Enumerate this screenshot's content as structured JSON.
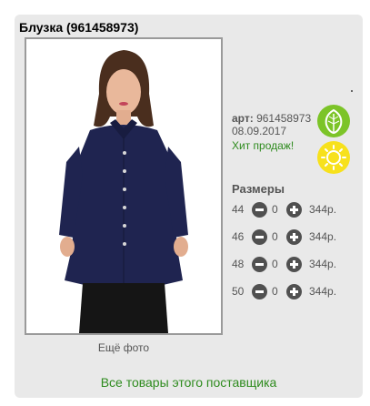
{
  "product": {
    "title": "Блузка (961458973)",
    "more_photos": "Ещё фото",
    "art_label": "арт:",
    "art_value": "961458973",
    "date": "08.09.2017",
    "hit": "Хит продаж!",
    "badges": [
      "leaf-icon",
      "sun-icon"
    ],
    "colors": {
      "accent_green": "#2e8b1e",
      "leaf_badge": "#7cc428",
      "sun_badge": "#f7e11c"
    }
  },
  "sizes": {
    "title": "Размеры",
    "rows": [
      {
        "size": "44",
        "qty": "0",
        "price": "344р."
      },
      {
        "size": "46",
        "qty": "0",
        "price": "344р."
      },
      {
        "size": "48",
        "qty": "0",
        "price": "344р."
      },
      {
        "size": "50",
        "qty": "0",
        "price": "344р."
      }
    ]
  },
  "footer": {
    "supplier_link": "Все товары этого поставщика"
  }
}
